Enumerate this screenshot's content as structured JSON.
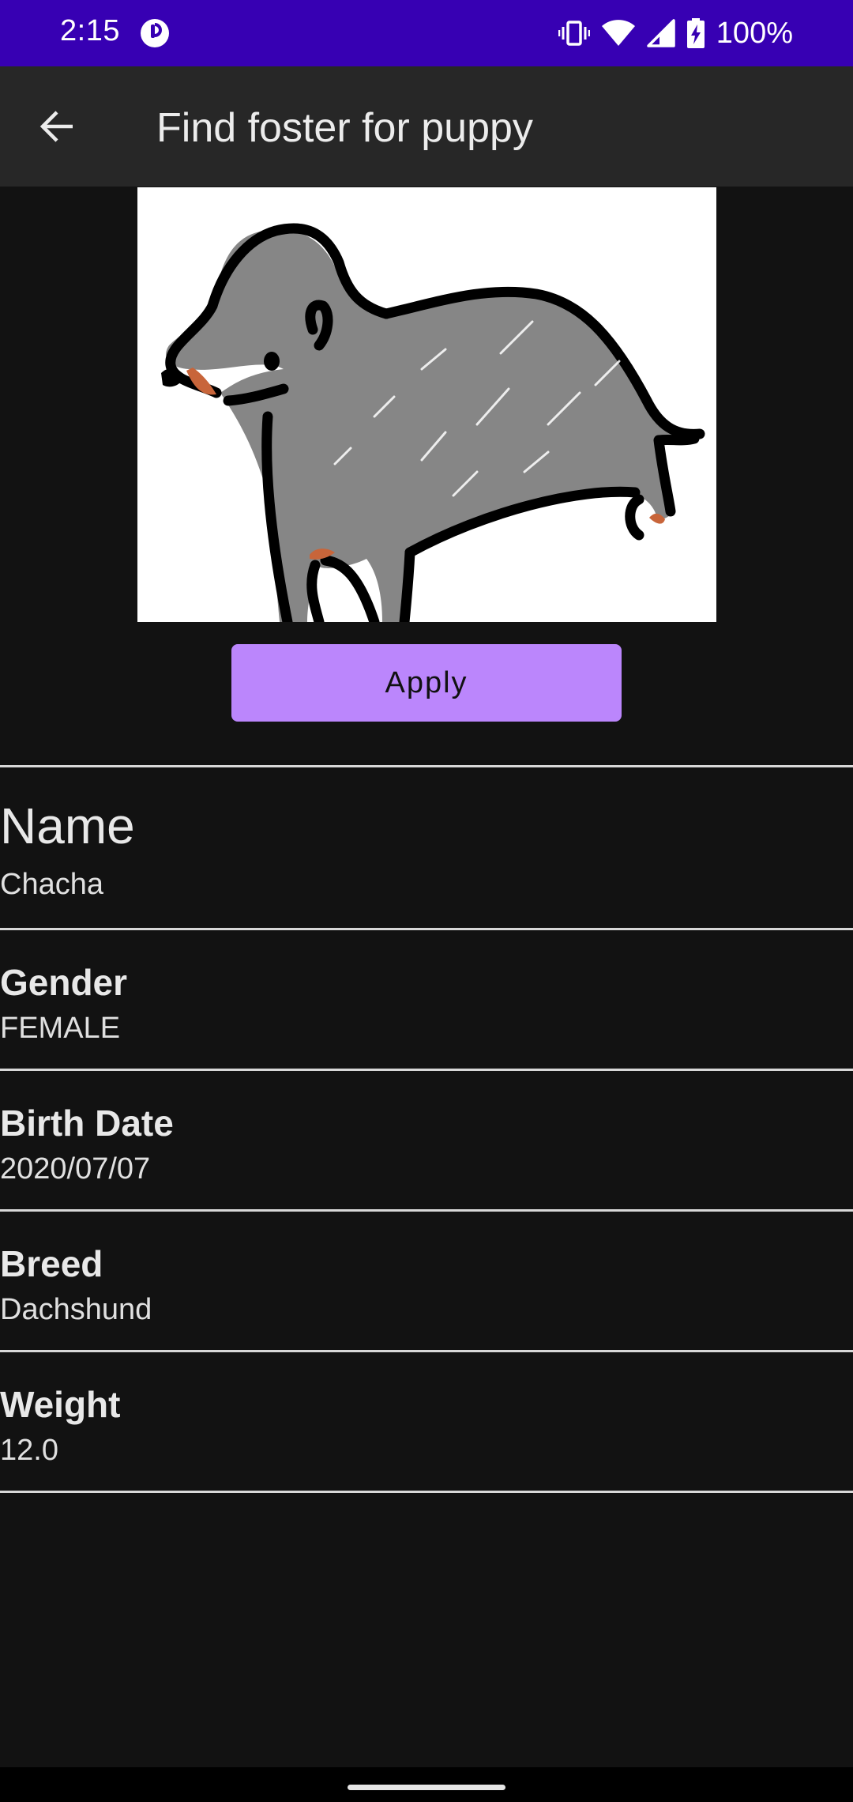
{
  "status_bar": {
    "time": "2:15",
    "battery": "100%",
    "icons": [
      "app-notification-icon",
      "vibrate-icon",
      "wifi-icon",
      "signal-icon",
      "battery-charging-icon"
    ]
  },
  "app_bar": {
    "title": "Find foster for puppy",
    "back_icon": "back-arrow-icon"
  },
  "colors": {
    "status_bar": "#3700b3",
    "app_bar": "#272727",
    "background": "#121212",
    "accent": "#bb86fc"
  },
  "puppy": {
    "image": "dachshund-drawing",
    "apply_label": "Apply"
  },
  "details": {
    "name": {
      "label": "Name",
      "value": "Chacha"
    },
    "gender": {
      "label": "Gender",
      "value": "FEMALE"
    },
    "birth_date": {
      "label": "Birth Date",
      "value": "2020/07/07"
    },
    "breed": {
      "label": "Breed",
      "value": "Dachshund"
    },
    "weight": {
      "label": "Weight",
      "value": "12.0"
    }
  }
}
